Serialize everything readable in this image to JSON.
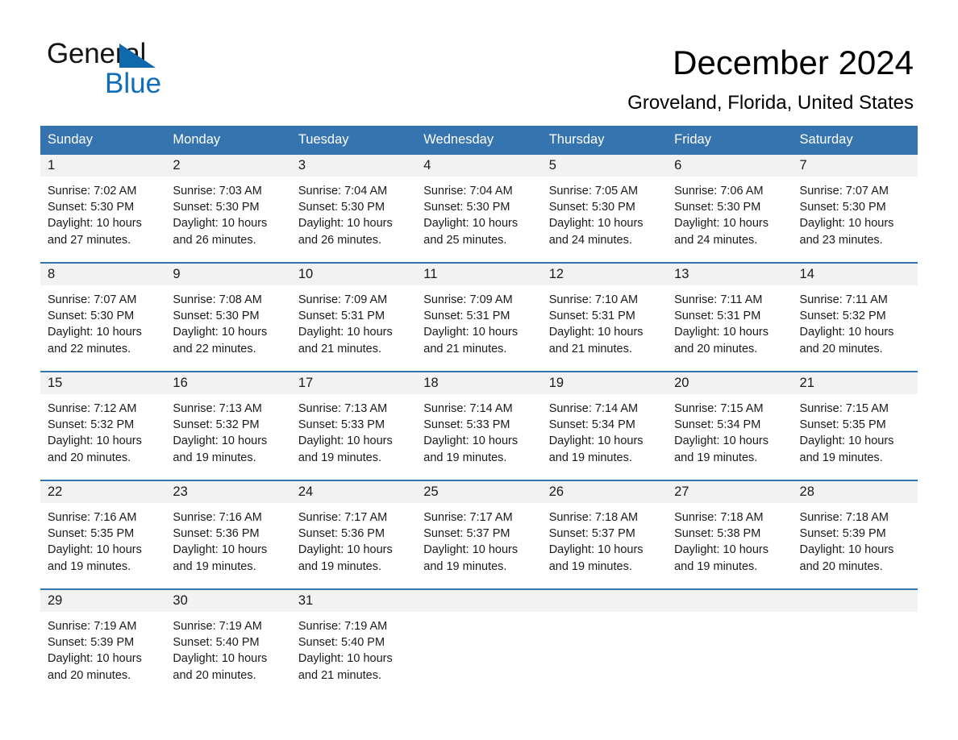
{
  "brand": {
    "name_part1": "General",
    "name_part2": "Blue",
    "accent_color": "#0f6dba",
    "triangle_color": "#1068ad"
  },
  "header": {
    "title": "December 2024",
    "subtitle": "Groveland, Florida, United States",
    "header_bg_color": "#3574ae",
    "daynum_bg_color": "#f2f2f2"
  },
  "calendar": {
    "weekday_headers": [
      "Sunday",
      "Monday",
      "Tuesday",
      "Wednesday",
      "Thursday",
      "Friday",
      "Saturday"
    ],
    "weeks": [
      [
        {
          "day": "1",
          "sunrise": "Sunrise: 7:02 AM",
          "sunset": "Sunset: 5:30 PM",
          "daylight1": "Daylight: 10 hours",
          "daylight2": "and 27 minutes."
        },
        {
          "day": "2",
          "sunrise": "Sunrise: 7:03 AM",
          "sunset": "Sunset: 5:30 PM",
          "daylight1": "Daylight: 10 hours",
          "daylight2": "and 26 minutes."
        },
        {
          "day": "3",
          "sunrise": "Sunrise: 7:04 AM",
          "sunset": "Sunset: 5:30 PM",
          "daylight1": "Daylight: 10 hours",
          "daylight2": "and 26 minutes."
        },
        {
          "day": "4",
          "sunrise": "Sunrise: 7:04 AM",
          "sunset": "Sunset: 5:30 PM",
          "daylight1": "Daylight: 10 hours",
          "daylight2": "and 25 minutes."
        },
        {
          "day": "5",
          "sunrise": "Sunrise: 7:05 AM",
          "sunset": "Sunset: 5:30 PM",
          "daylight1": "Daylight: 10 hours",
          "daylight2": "and 24 minutes."
        },
        {
          "day": "6",
          "sunrise": "Sunrise: 7:06 AM",
          "sunset": "Sunset: 5:30 PM",
          "daylight1": "Daylight: 10 hours",
          "daylight2": "and 24 minutes."
        },
        {
          "day": "7",
          "sunrise": "Sunrise: 7:07 AM",
          "sunset": "Sunset: 5:30 PM",
          "daylight1": "Daylight: 10 hours",
          "daylight2": "and 23 minutes."
        }
      ],
      [
        {
          "day": "8",
          "sunrise": "Sunrise: 7:07 AM",
          "sunset": "Sunset: 5:30 PM",
          "daylight1": "Daylight: 10 hours",
          "daylight2": "and 22 minutes."
        },
        {
          "day": "9",
          "sunrise": "Sunrise: 7:08 AM",
          "sunset": "Sunset: 5:30 PM",
          "daylight1": "Daylight: 10 hours",
          "daylight2": "and 22 minutes."
        },
        {
          "day": "10",
          "sunrise": "Sunrise: 7:09 AM",
          "sunset": "Sunset: 5:31 PM",
          "daylight1": "Daylight: 10 hours",
          "daylight2": "and 21 minutes."
        },
        {
          "day": "11",
          "sunrise": "Sunrise: 7:09 AM",
          "sunset": "Sunset: 5:31 PM",
          "daylight1": "Daylight: 10 hours",
          "daylight2": "and 21 minutes."
        },
        {
          "day": "12",
          "sunrise": "Sunrise: 7:10 AM",
          "sunset": "Sunset: 5:31 PM",
          "daylight1": "Daylight: 10 hours",
          "daylight2": "and 21 minutes."
        },
        {
          "day": "13",
          "sunrise": "Sunrise: 7:11 AM",
          "sunset": "Sunset: 5:31 PM",
          "daylight1": "Daylight: 10 hours",
          "daylight2": "and 20 minutes."
        },
        {
          "day": "14",
          "sunrise": "Sunrise: 7:11 AM",
          "sunset": "Sunset: 5:32 PM",
          "daylight1": "Daylight: 10 hours",
          "daylight2": "and 20 minutes."
        }
      ],
      [
        {
          "day": "15",
          "sunrise": "Sunrise: 7:12 AM",
          "sunset": "Sunset: 5:32 PM",
          "daylight1": "Daylight: 10 hours",
          "daylight2": "and 20 minutes."
        },
        {
          "day": "16",
          "sunrise": "Sunrise: 7:13 AM",
          "sunset": "Sunset: 5:32 PM",
          "daylight1": "Daylight: 10 hours",
          "daylight2": "and 19 minutes."
        },
        {
          "day": "17",
          "sunrise": "Sunrise: 7:13 AM",
          "sunset": "Sunset: 5:33 PM",
          "daylight1": "Daylight: 10 hours",
          "daylight2": "and 19 minutes."
        },
        {
          "day": "18",
          "sunrise": "Sunrise: 7:14 AM",
          "sunset": "Sunset: 5:33 PM",
          "daylight1": "Daylight: 10 hours",
          "daylight2": "and 19 minutes."
        },
        {
          "day": "19",
          "sunrise": "Sunrise: 7:14 AM",
          "sunset": "Sunset: 5:34 PM",
          "daylight1": "Daylight: 10 hours",
          "daylight2": "and 19 minutes."
        },
        {
          "day": "20",
          "sunrise": "Sunrise: 7:15 AM",
          "sunset": "Sunset: 5:34 PM",
          "daylight1": "Daylight: 10 hours",
          "daylight2": "and 19 minutes."
        },
        {
          "day": "21",
          "sunrise": "Sunrise: 7:15 AM",
          "sunset": "Sunset: 5:35 PM",
          "daylight1": "Daylight: 10 hours",
          "daylight2": "and 19 minutes."
        }
      ],
      [
        {
          "day": "22",
          "sunrise": "Sunrise: 7:16 AM",
          "sunset": "Sunset: 5:35 PM",
          "daylight1": "Daylight: 10 hours",
          "daylight2": "and 19 minutes."
        },
        {
          "day": "23",
          "sunrise": "Sunrise: 7:16 AM",
          "sunset": "Sunset: 5:36 PM",
          "daylight1": "Daylight: 10 hours",
          "daylight2": "and 19 minutes."
        },
        {
          "day": "24",
          "sunrise": "Sunrise: 7:17 AM",
          "sunset": "Sunset: 5:36 PM",
          "daylight1": "Daylight: 10 hours",
          "daylight2": "and 19 minutes."
        },
        {
          "day": "25",
          "sunrise": "Sunrise: 7:17 AM",
          "sunset": "Sunset: 5:37 PM",
          "daylight1": "Daylight: 10 hours",
          "daylight2": "and 19 minutes."
        },
        {
          "day": "26",
          "sunrise": "Sunrise: 7:18 AM",
          "sunset": "Sunset: 5:37 PM",
          "daylight1": "Daylight: 10 hours",
          "daylight2": "and 19 minutes."
        },
        {
          "day": "27",
          "sunrise": "Sunrise: 7:18 AM",
          "sunset": "Sunset: 5:38 PM",
          "daylight1": "Daylight: 10 hours",
          "daylight2": "and 19 minutes."
        },
        {
          "day": "28",
          "sunrise": "Sunrise: 7:18 AM",
          "sunset": "Sunset: 5:39 PM",
          "daylight1": "Daylight: 10 hours",
          "daylight2": "and 20 minutes."
        }
      ],
      [
        {
          "day": "29",
          "sunrise": "Sunrise: 7:19 AM",
          "sunset": "Sunset: 5:39 PM",
          "daylight1": "Daylight: 10 hours",
          "daylight2": "and 20 minutes."
        },
        {
          "day": "30",
          "sunrise": "Sunrise: 7:19 AM",
          "sunset": "Sunset: 5:40 PM",
          "daylight1": "Daylight: 10 hours",
          "daylight2": "and 20 minutes."
        },
        {
          "day": "31",
          "sunrise": "Sunrise: 7:19 AM",
          "sunset": "Sunset: 5:40 PM",
          "daylight1": "Daylight: 10 hours",
          "daylight2": "and 21 minutes."
        },
        {
          "day": "",
          "sunrise": "",
          "sunset": "",
          "daylight1": "",
          "daylight2": ""
        },
        {
          "day": "",
          "sunrise": "",
          "sunset": "",
          "daylight1": "",
          "daylight2": ""
        },
        {
          "day": "",
          "sunrise": "",
          "sunset": "",
          "daylight1": "",
          "daylight2": ""
        },
        {
          "day": "",
          "sunrise": "",
          "sunset": "",
          "daylight1": "",
          "daylight2": ""
        }
      ]
    ]
  }
}
